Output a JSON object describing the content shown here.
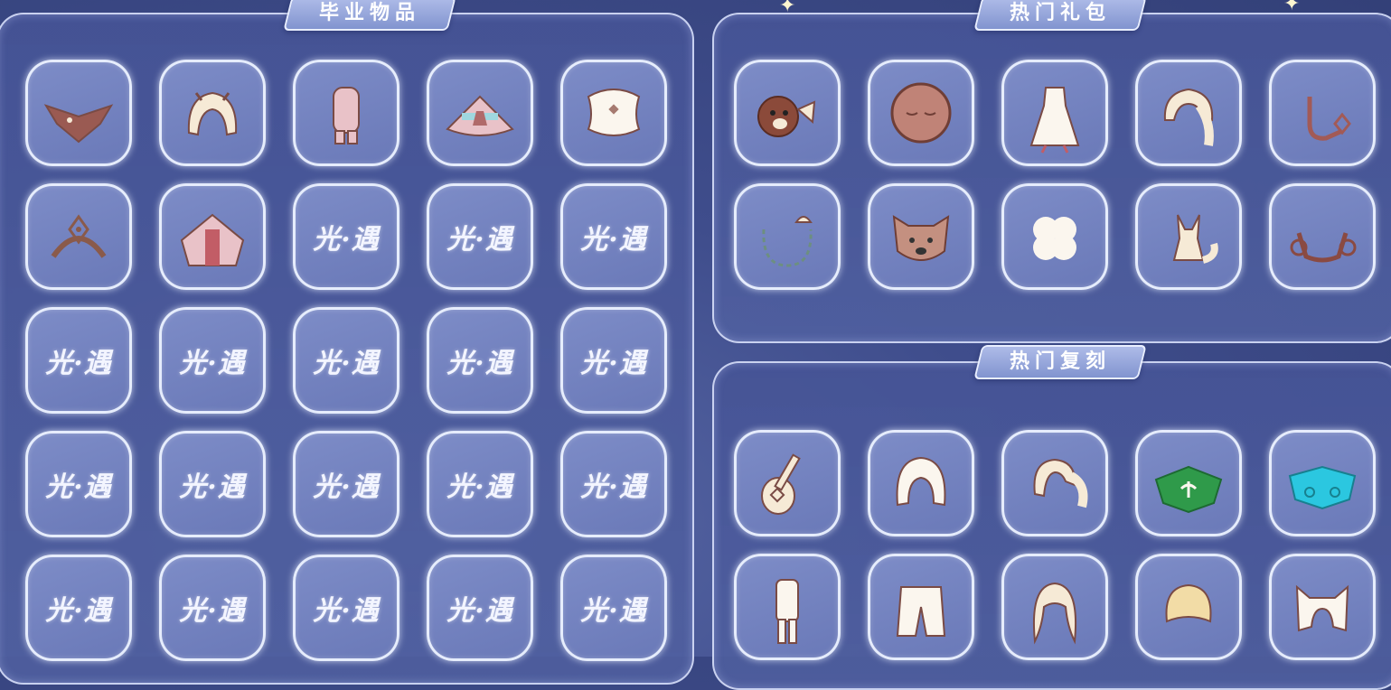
{
  "sections": {
    "graduation": {
      "title": "毕业物品"
    },
    "gifts": {
      "title": "热门礼包"
    },
    "reissue": {
      "title": "热门复刻"
    }
  },
  "placeholder_logo": "光·遇",
  "graduation_items": [
    "bat-cape-icon",
    "fluffy-hair-icon",
    "pink-outfit-icon",
    "bow-cape-icon",
    "wing-mask-icon",
    "gem-mask-icon",
    "pink-hood-cape-icon",
    "placeholder",
    "placeholder",
    "placeholder",
    "placeholder",
    "placeholder",
    "placeholder",
    "placeholder",
    "placeholder",
    "placeholder",
    "placeholder",
    "placeholder",
    "placeholder",
    "placeholder",
    "placeholder",
    "placeholder",
    "placeholder",
    "placeholder",
    "placeholder"
  ],
  "gift_items": [
    "bear-hat-icon",
    "sleepy-mask-icon",
    "white-dress-icon",
    "ponytail-hair-icon",
    "hook-earring-icon",
    "shell-necklace-icon",
    "dog-mask-icon",
    "clover-icon",
    "fox-icon",
    "sun-mask-icon"
  ],
  "reissue_items": [
    "guitar-icon",
    "bob-hair-icon",
    "twin-tail-hair-icon",
    "green-leaf-cape-icon",
    "cyan-cloud-cape-icon",
    "tall-outfit-icon",
    "puffy-pants-icon",
    "long-wavy-hair-icon",
    "short-hair-icon",
    "cat-ear-hair-icon"
  ]
}
